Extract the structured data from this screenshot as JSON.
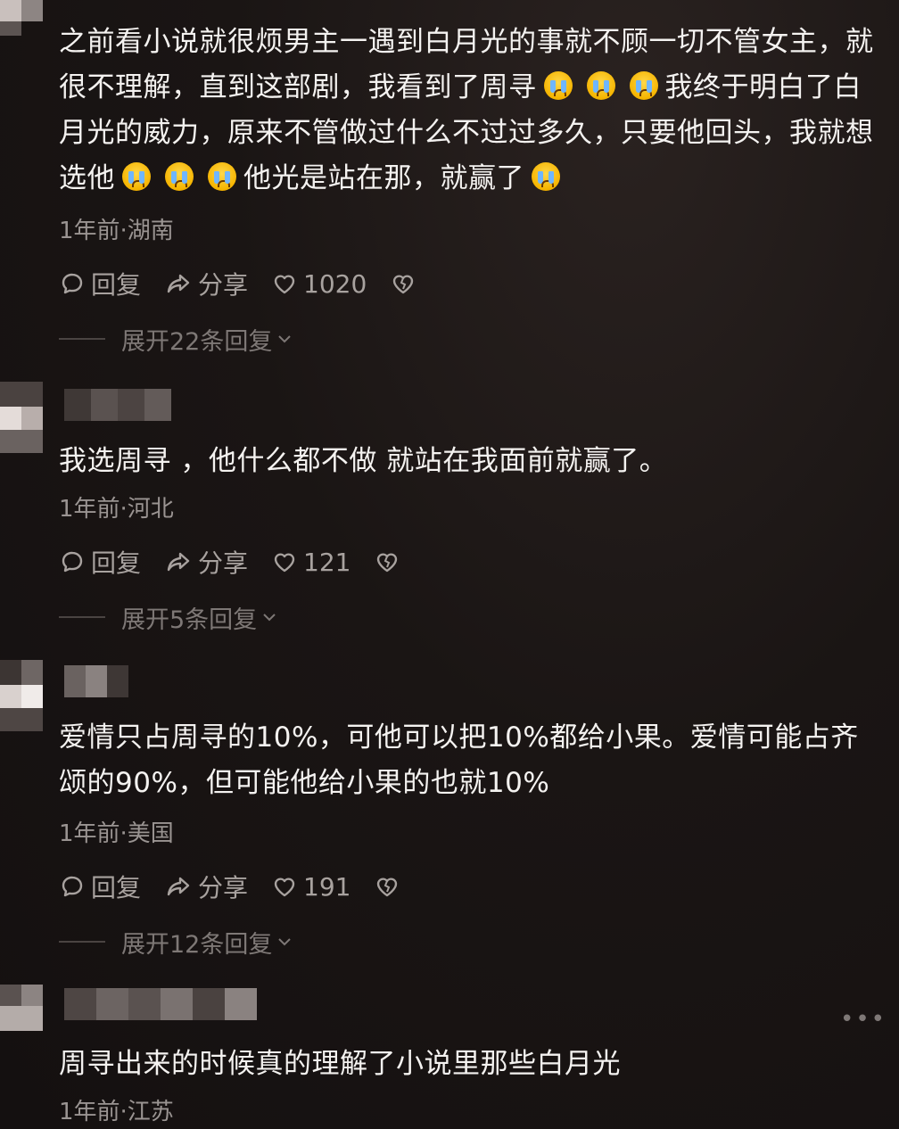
{
  "comments": [
    {
      "text_parts": [
        "之前看小说就很烦男主一遇到白月光的事就不顾一切不管女主，就很不理解，直到这部剧，我看到了周寻",
        "我终于明白了白月光的威力，原来不管做过什么不过过多久，只要他回头，我就想选他",
        "他光是站在那，就赢了"
      ],
      "meta": "1年前·湖南",
      "reply_label": "回复",
      "share_label": "分享",
      "likes": "1020",
      "expand_label": "展开22条回复"
    },
    {
      "text": "我选周寻 ，他什么都不做 就站在我面前就赢了。",
      "meta": "1年前·河北",
      "reply_label": "回复",
      "share_label": "分享",
      "likes": "121",
      "expand_label": "展开5条回复"
    },
    {
      "text": "爱情只占周寻的10%，可他可以把10%都给小果。爱情可能占齐颂的90%，但可能他给小果的也就10%",
      "meta": "1年前·美国",
      "reply_label": "回复",
      "share_label": "分享",
      "likes": "191",
      "expand_label": "展开12条回复"
    },
    {
      "text": "周寻出来的时候真的理解了小说里那些白月光",
      "meta": "1年前·江苏",
      "more": "•••"
    }
  ],
  "icons": {
    "reply": "reply-bubble-icon",
    "share": "share-arrow-icon",
    "like": "heart-icon",
    "dislike": "broken-heart-icon",
    "expand": "chevron-down-icon",
    "emoji": "loudly-crying-face-emoji",
    "more": "more-dots-icon"
  }
}
